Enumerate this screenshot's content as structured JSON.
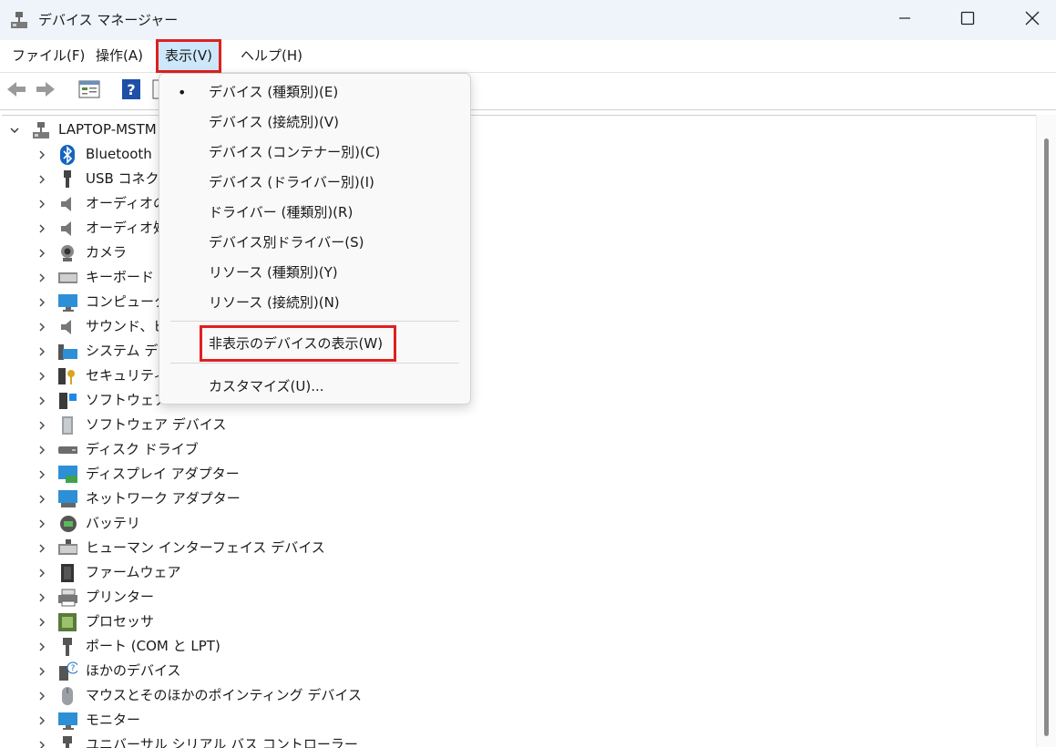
{
  "window": {
    "title": "デバイス マネージャー"
  },
  "menu": {
    "file": "ファイル(F)",
    "action": "操作(A)",
    "view": "表示(V)",
    "help": "ヘルプ(H)"
  },
  "tree": {
    "root": "LAPTOP-MSTM",
    "items": [
      {
        "label": "Bluetooth",
        "icon": "bluetooth-icon"
      },
      {
        "label": "USB コネク",
        "icon": "usb-connector-icon"
      },
      {
        "label": "オーディオの",
        "icon": "speaker-icon"
      },
      {
        "label": "オーディオ処",
        "icon": "speaker-icon"
      },
      {
        "label": "カメラ",
        "icon": "camera-icon"
      },
      {
        "label": "キーボード",
        "icon": "keyboard-icon"
      },
      {
        "label": "コンピューター",
        "icon": "monitor-icon"
      },
      {
        "label": "サウンド、ビ",
        "icon": "speaker-icon"
      },
      {
        "label": "システム デバ",
        "icon": "system-device-icon"
      },
      {
        "label": "セキュリティ",
        "icon": "security-key-icon"
      },
      {
        "label": "ソフトウェア",
        "icon": "software-component-icon"
      },
      {
        "label": "ソフトウェア デバイス",
        "icon": "software-device-icon"
      },
      {
        "label": "ディスク ドライブ",
        "icon": "disk-drive-icon"
      },
      {
        "label": "ディスプレイ アダプター",
        "icon": "display-adapter-icon"
      },
      {
        "label": "ネットワーク アダプター",
        "icon": "network-adapter-icon"
      },
      {
        "label": "バッテリ",
        "icon": "battery-icon"
      },
      {
        "label": "ヒューマン インターフェイス デバイス",
        "icon": "hid-icon"
      },
      {
        "label": "ファームウェア",
        "icon": "firmware-chip-icon"
      },
      {
        "label": "プリンター",
        "icon": "printer-icon"
      },
      {
        "label": "プロセッサ",
        "icon": "processor-icon"
      },
      {
        "label": "ポート (COM と LPT)",
        "icon": "port-icon"
      },
      {
        "label": "ほかのデバイス",
        "icon": "other-device-icon"
      },
      {
        "label": "マウスとそのほかのポインティング デバイス",
        "icon": "mouse-icon"
      },
      {
        "label": "モニター",
        "icon": "monitor-icon"
      },
      {
        "label": "ユニバーサル シリアル バス コントローラー",
        "icon": "usb-controller-icon"
      }
    ]
  },
  "view_menu": {
    "items": [
      {
        "label": "デバイス (種類別)(E)",
        "checked": true
      },
      {
        "label": "デバイス (接続別)(V)"
      },
      {
        "label": "デバイス (コンテナー別)(C)"
      },
      {
        "label": "デバイス (ドライバー別)(I)"
      },
      {
        "label": "ドライバー (種類別)(R)"
      },
      {
        "label": "デバイス別ドライバー(S)"
      },
      {
        "label": "リソース (種類別)(Y)"
      },
      {
        "label": "リソース (接続別)(N)"
      }
    ],
    "show_hidden": "非表示のデバイスの表示(W)",
    "customize": "カスタマイズ(U)...",
    "bullet": "•"
  },
  "colors": {
    "highlight": "#e02020",
    "menu_active_bg": "#cde8fb",
    "accent": "#0067c0"
  }
}
